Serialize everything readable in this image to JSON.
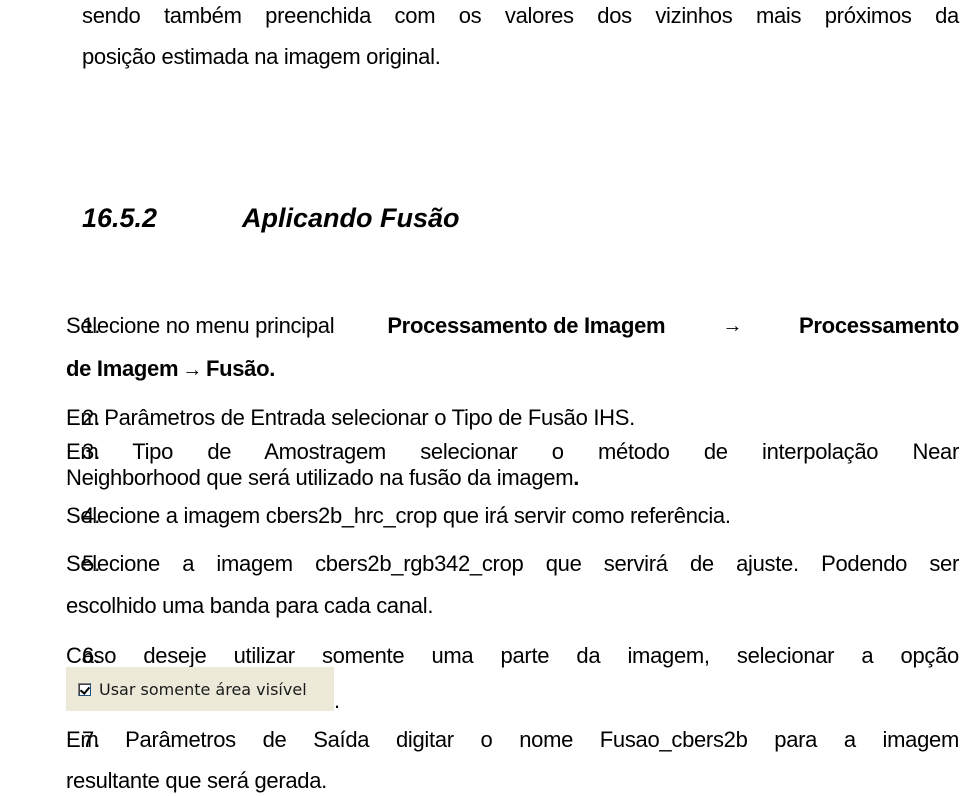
{
  "intro": {
    "line1": "sendo também preenchida com os valores dos vizinhos mais próximos da",
    "line2": "posição estimada na imagem original."
  },
  "section": {
    "number": "16.5.2",
    "title": "Aplicando Fusão"
  },
  "steps": [
    {
      "num": "1.",
      "prefix": "Selecione no menu principal ",
      "bold1": "Processamento de Imagem",
      "arrow": "→",
      "bold2": "Processamento",
      "line2_bold1": "de Imagem",
      "line2_bold2": "Fusão."
    },
    {
      "num": "2.",
      "text": "Em Parâmetros de Entrada selecionar o Tipo de Fusão IHS."
    },
    {
      "num": "3.",
      "line1": "Em Tipo de Amostragem selecionar o método de interpolação Near",
      "line2": "Neighborhood que será utilizado na fusão da imagem",
      "line2_end": "."
    },
    {
      "num": "4.",
      "text": "Selecione a imagem cbers2b_hrc_crop que irá servir como referência."
    },
    {
      "num": "5.",
      "line1": "Selecione a imagem cbers2b_rgb342_crop que servirá de ajuste. Podendo ser",
      "line2": "escolhido uma banda para cada canal."
    },
    {
      "num": "6.",
      "line1": "Caso deseje utilizar somente uma parte da imagem, selecionar a opção",
      "checkbox_label": "Usar somente área visível",
      "checkbox_checked": true,
      "line2_end": "."
    },
    {
      "num": "7.",
      "line1": "Em Parâmetros de Saída digitar o nome Fusao_cbers2b para a imagem",
      "line2": "resultante que será gerada."
    }
  ],
  "colors": {
    "text": "#000000",
    "checkbox_panel": "#ece9d8"
  }
}
